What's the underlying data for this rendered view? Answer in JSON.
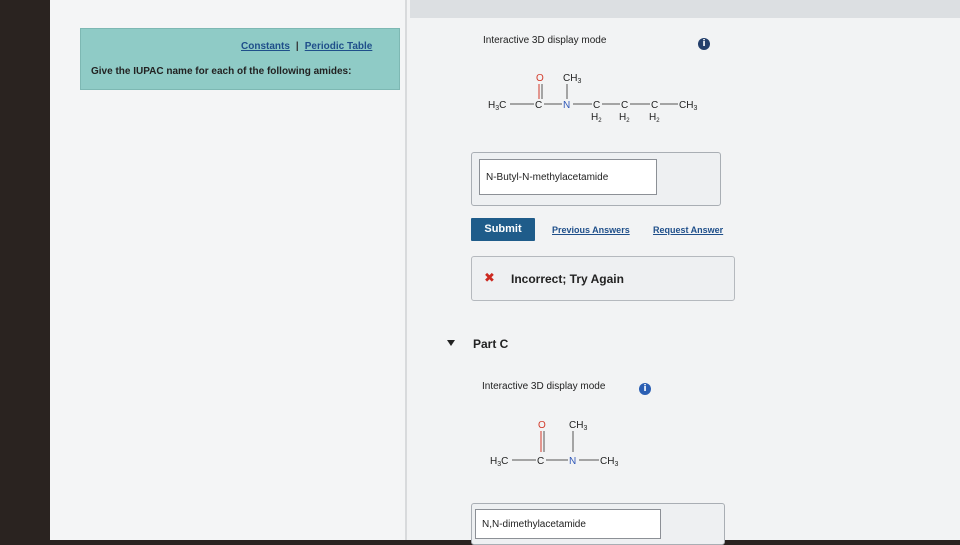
{
  "header": {
    "links": [
      "Constants",
      "Periodic Table"
    ],
    "separator": "|",
    "instruction": "Give the IUPAC name for each of the following amides:"
  },
  "part_b": {
    "display_mode": "Interactive 3D display mode",
    "info_icon": "info-icon",
    "answer": "N-Butyl-N-methylacetamide",
    "submit_label": "Submit",
    "previous_answers": "Previous Answers",
    "request_answer": "Request Answer",
    "feedback": "Incorrect; Try Again",
    "feedback_icon": "x-icon"
  },
  "part_c": {
    "label": "Part C",
    "display_mode": "Interactive 3D display mode",
    "info_icon": "info-icon",
    "answer": "N,N-dimethylacetamide"
  },
  "colors": {
    "panel": "#8fcbc6",
    "submit": "#1f5c8a",
    "link": "#1f4f8a",
    "incorrect": "#cc2a21",
    "info": "#2b5fb3"
  }
}
